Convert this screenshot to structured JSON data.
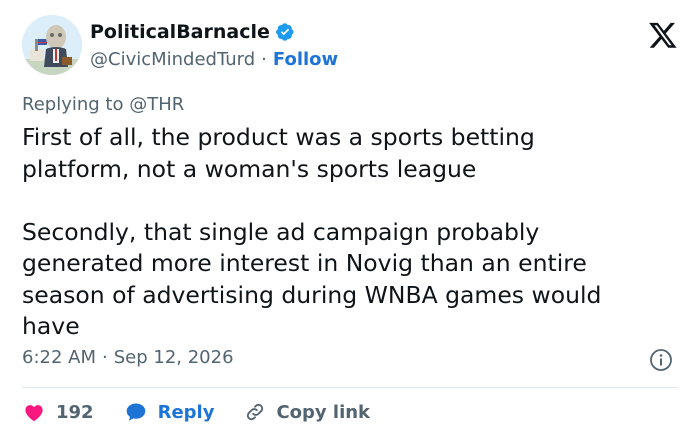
{
  "author": {
    "display_name": "PoliticalBarnacle",
    "handle": "@CivicMindedTurd",
    "follow_label": "Follow",
    "verified_icon": "verified-badge-icon"
  },
  "platform": {
    "logo_icon": "x-logo-icon"
  },
  "reply_context": {
    "prefix": "Replying to",
    "target": "@THR"
  },
  "body": {
    "paragraph_1_lines": [
      "First of all, the product was a sports betting",
      "platform, not a woman's sports league"
    ],
    "paragraph_2_lines": [
      "Secondly, that single ad campaign probably",
      "generated more interest in Novig than an entire",
      "season of advertising during WNBA games would",
      "have"
    ]
  },
  "meta": {
    "time": "6:22 AM",
    "separator": "·",
    "date": "Sep 12, 2026"
  },
  "actions": {
    "like_count": "192",
    "reply_label": "Reply",
    "copy_link_label": "Copy link"
  },
  "colors": {
    "accent": "#1d74d5",
    "like": "#f91880",
    "muted": "#536471",
    "text": "#0f1419"
  }
}
